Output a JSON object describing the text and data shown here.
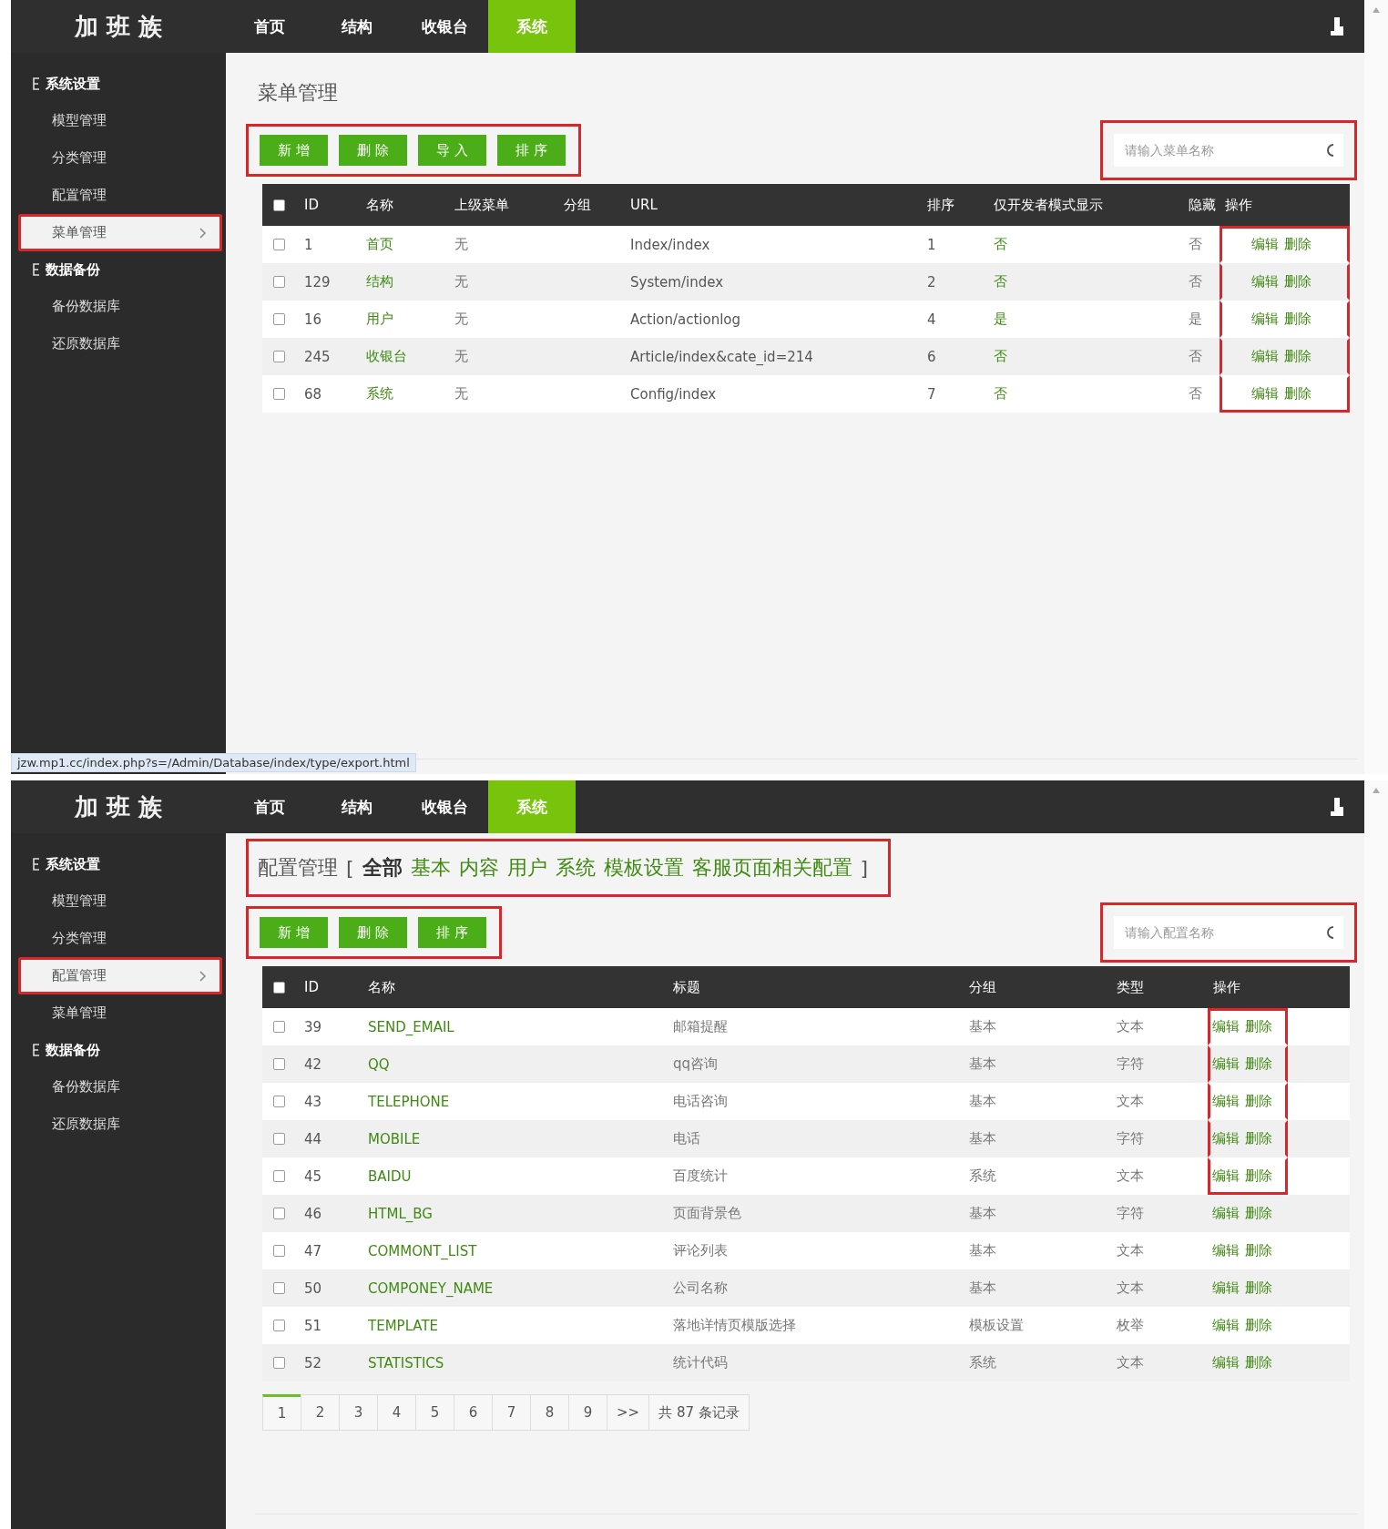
{
  "screens": [
    {
      "brand": "加 班 族",
      "nav": [
        {
          "label": "首页",
          "selected": false
        },
        {
          "label": "结构",
          "selected": false
        },
        {
          "label": "收银台",
          "selected": false
        },
        {
          "label": "系统",
          "selected": true
        }
      ],
      "sidebar": [
        {
          "label": "系统设置",
          "children": [
            {
              "label": "模型管理",
              "selected": false,
              "highlighted": false
            },
            {
              "label": "分类管理",
              "selected": false,
              "highlighted": false
            },
            {
              "label": "配置管理",
              "selected": false,
              "highlighted": false
            },
            {
              "label": "菜单管理",
              "selected": true,
              "highlighted": true
            }
          ]
        },
        {
          "label": "数据备份",
          "children": [
            {
              "label": "备份数据库",
              "selected": false,
              "highlighted": false
            },
            {
              "label": "还原数据库",
              "selected": false,
              "highlighted": false
            }
          ]
        }
      ],
      "heading": {
        "title": "菜单管理",
        "highlighted": false
      },
      "toolbar": {
        "highlighted": true,
        "buttons": [
          "新 增",
          "删 除",
          "导 入",
          "排 序"
        ]
      },
      "search": {
        "placeholder": "请输入菜单名称",
        "highlighted": true
      },
      "table": {
        "all_checked": false,
        "columns": [
          {
            "label": "ID",
            "kind": "dark"
          },
          {
            "label": "名称",
            "kind": "green"
          },
          {
            "label": "上级菜单",
            "kind": "muted"
          },
          {
            "label": "分组",
            "kind": "muted"
          },
          {
            "label": "URL",
            "kind": "dark"
          },
          {
            "label": "排序",
            "kind": "dark"
          },
          {
            "label": "仅开发者模式显示",
            "kind": "green"
          },
          {
            "label": "隐藏",
            "kind": "muted"
          },
          {
            "label": "操作",
            "kind": "ops"
          }
        ],
        "rows": [
          {
            "checked": false,
            "ops_highlighted": true,
            "cells": [
              "1",
              "首页",
              "无",
              "",
              "Index/index",
              "1",
              "否",
              "否"
            ],
            "ops": [
              "编辑",
              "删除"
            ]
          },
          {
            "checked": false,
            "ops_highlighted": true,
            "cells": [
              "129",
              "结构",
              "无",
              "",
              "System/index",
              "2",
              "否",
              "否"
            ],
            "ops": [
              "编辑",
              "删除"
            ]
          },
          {
            "checked": false,
            "ops_highlighted": true,
            "cells": [
              "16",
              "用户",
              "无",
              "",
              "Action/actionlog",
              "4",
              "是",
              "是"
            ],
            "ops": [
              "编辑",
              "删除"
            ]
          },
          {
            "checked": false,
            "ops_highlighted": true,
            "cells": [
              "245",
              "收银台",
              "无",
              "",
              "Article/index&cate_id=214",
              "6",
              "否",
              "否"
            ],
            "ops": [
              "编辑",
              "删除"
            ]
          },
          {
            "checked": false,
            "ops_highlighted": true,
            "cells": [
              "68",
              "系统",
              "无",
              "",
              "Config/index",
              "7",
              "否",
              "否"
            ],
            "ops": [
              "编辑",
              "删除"
            ]
          }
        ]
      },
      "status_bar": "jzw.mp1.cc/index.php?s=/Admin/Database/index/type/export.html"
    },
    {
      "brand": "加 班 族",
      "nav": [
        {
          "label": "首页",
          "selected": false
        },
        {
          "label": "结构",
          "selected": false
        },
        {
          "label": "收银台",
          "selected": false
        },
        {
          "label": "系统",
          "selected": true
        }
      ],
      "sidebar": [
        {
          "label": "系统设置",
          "children": [
            {
              "label": "模型管理",
              "selected": false,
              "highlighted": false
            },
            {
              "label": "分类管理",
              "selected": false,
              "highlighted": false
            },
            {
              "label": "配置管理",
              "selected": true,
              "highlighted": true
            },
            {
              "label": "菜单管理",
              "selected": false,
              "highlighted": false
            }
          ]
        },
        {
          "label": "数据备份",
          "children": [
            {
              "label": "备份数据库",
              "selected": false,
              "highlighted": false
            },
            {
              "label": "还原数据库",
              "selected": false,
              "highlighted": false
            }
          ]
        }
      ],
      "heading": {
        "title": "配置管理",
        "highlighted": true,
        "open": "[",
        "close": "]",
        "filters": [
          {
            "label": "全部",
            "selected": true
          },
          {
            "label": "基本",
            "selected": false
          },
          {
            "label": "内容",
            "selected": false
          },
          {
            "label": "用户",
            "selected": false
          },
          {
            "label": "系统",
            "selected": false
          },
          {
            "label": "模板设置",
            "selected": false
          },
          {
            "label": "客服页面相关配置",
            "selected": false
          }
        ]
      },
      "toolbar": {
        "highlighted": true,
        "buttons": [
          "新 增",
          "删 除",
          "排 序"
        ]
      },
      "search": {
        "placeholder": "请输入配置名称",
        "highlighted": true
      },
      "table": {
        "all_checked": false,
        "columns": [
          {
            "label": "ID",
            "kind": "dark"
          },
          {
            "label": "名称",
            "kind": "green"
          },
          {
            "label": "标题",
            "kind": "muted"
          },
          {
            "label": "分组",
            "kind": "muted"
          },
          {
            "label": "类型",
            "kind": "muted"
          },
          {
            "label": "操作",
            "kind": "ops"
          }
        ],
        "rows": [
          {
            "checked": false,
            "ops_highlighted": true,
            "cells": [
              "39",
              "SEND_EMAIL",
              "邮箱提醒",
              "基本",
              "文本"
            ],
            "ops": [
              "编辑",
              "删除"
            ]
          },
          {
            "checked": false,
            "ops_highlighted": true,
            "cells": [
              "42",
              "QQ",
              "qq咨询",
              "基本",
              "字符"
            ],
            "ops": [
              "编辑",
              "删除"
            ]
          },
          {
            "checked": false,
            "ops_highlighted": true,
            "cells": [
              "43",
              "TELEPHONE",
              "电话咨询",
              "基本",
              "文本"
            ],
            "ops": [
              "编辑",
              "删除"
            ]
          },
          {
            "checked": false,
            "ops_highlighted": true,
            "cells": [
              "44",
              "MOBILE",
              "电话",
              "基本",
              "字符"
            ],
            "ops": [
              "编辑",
              "删除"
            ]
          },
          {
            "checked": false,
            "ops_highlighted": true,
            "cells": [
              "45",
              "BAIDU",
              "百度统计",
              "系统",
              "文本"
            ],
            "ops": [
              "编辑",
              "删除"
            ]
          },
          {
            "checked": false,
            "ops_highlighted": false,
            "cells": [
              "46",
              "HTML_BG",
              "页面背景色",
              "基本",
              "字符"
            ],
            "ops": [
              "编辑",
              "删除"
            ]
          },
          {
            "checked": false,
            "ops_highlighted": false,
            "cells": [
              "47",
              "COMMONT_LIST",
              "评论列表",
              "基本",
              "文本"
            ],
            "ops": [
              "编辑",
              "删除"
            ]
          },
          {
            "checked": false,
            "ops_highlighted": false,
            "cells": [
              "50",
              "COMPONEY_NAME",
              "公司名称",
              "基本",
              "文本"
            ],
            "ops": [
              "编辑",
              "删除"
            ]
          },
          {
            "checked": false,
            "ops_highlighted": false,
            "cells": [
              "51",
              "TEMPLATE",
              "落地详情页模版选择",
              "模板设置",
              "枚举"
            ],
            "ops": [
              "编辑",
              "删除"
            ]
          },
          {
            "checked": false,
            "ops_highlighted": false,
            "cells": [
              "52",
              "STATISTICS",
              "统计代码",
              "系统",
              "文本"
            ],
            "ops": [
              "编辑",
              "删除"
            ]
          }
        ]
      },
      "pagination": {
        "pages": [
          {
            "label": "1",
            "selected": true
          },
          {
            "label": "2",
            "selected": false
          },
          {
            "label": "3",
            "selected": false
          },
          {
            "label": "4",
            "selected": false
          },
          {
            "label": "5",
            "selected": false
          },
          {
            "label": "6",
            "selected": false
          },
          {
            "label": "7",
            "selected": false
          },
          {
            "label": "8",
            "selected": false
          },
          {
            "label": "9",
            "selected": false
          },
          {
            "label": ">>",
            "selected": false
          }
        ],
        "total": "共 87 条记录"
      }
    }
  ]
}
